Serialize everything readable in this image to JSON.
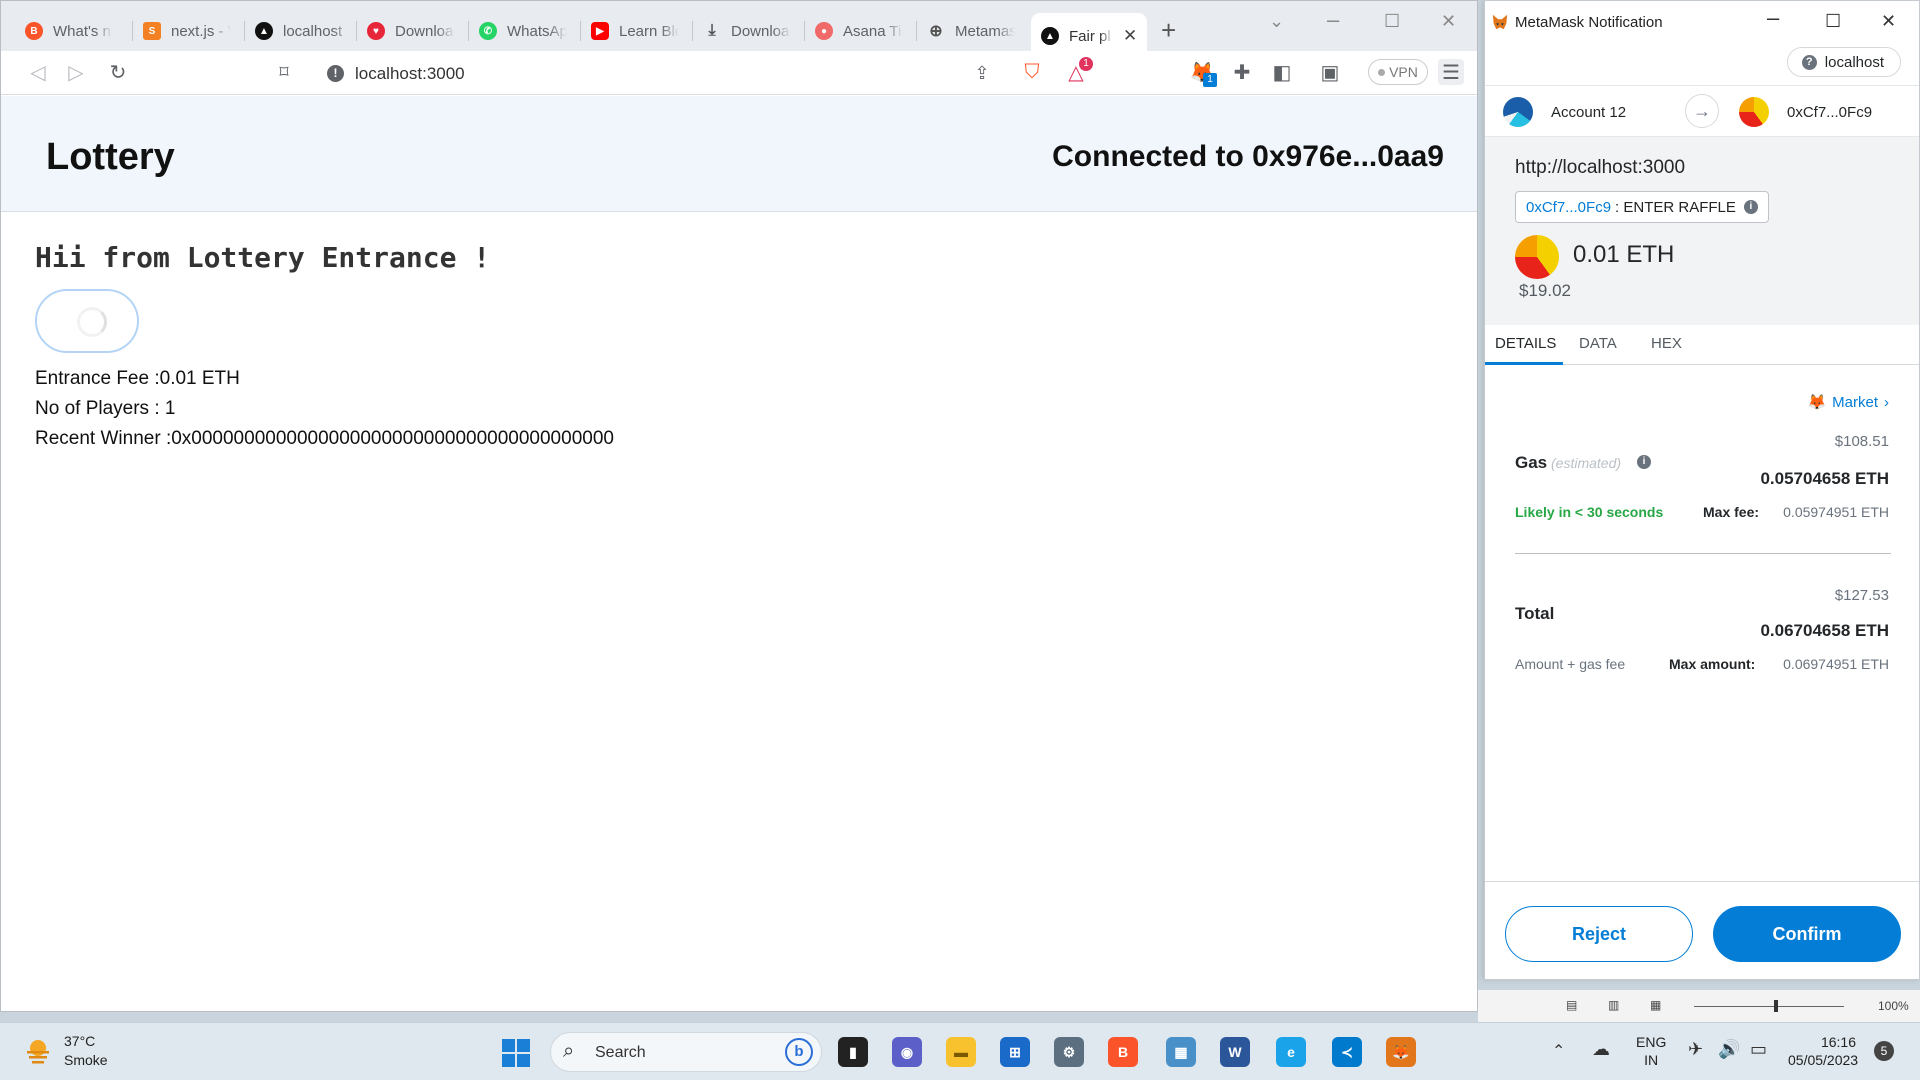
{
  "browser": {
    "tabs": [
      {
        "label": "What's ne",
        "icon": "brave-lion-icon"
      },
      {
        "label": "next.js - V",
        "icon": "stackoverflow-icon"
      },
      {
        "label": "localhost",
        "icon": "nextjs-icon"
      },
      {
        "label": "Download",
        "icon": "heart-icon"
      },
      {
        "label": "WhatsApp",
        "icon": "whatsapp-icon"
      },
      {
        "label": "Learn Bloc",
        "icon": "youtube-icon"
      },
      {
        "label": "Download",
        "icon": "download-icon"
      },
      {
        "label": "Asana Tim",
        "icon": "asana-icon"
      },
      {
        "label": "Metamask",
        "icon": "globe-icon"
      },
      {
        "label": "Fair pl",
        "icon": "nextjs-icon",
        "active": true
      }
    ],
    "url": "localhost:3000",
    "vpn_label": "VPN",
    "extension_badge": "1",
    "brave_rewards_badge": "1"
  },
  "page": {
    "title": "Lottery",
    "connected_text": "Connected to 0x976e...0aa9",
    "greeting": "Hii from Lottery Entrance !",
    "entrance_fee": "Entrance Fee :0.01 ETH",
    "players": "No of Players : 1",
    "recent_winner": "Recent Winner :0x0000000000000000000000000000000000000000"
  },
  "metamask": {
    "window_title": "MetaMask Notification",
    "network": "localhost",
    "from_account": "Account 12",
    "to_address": "0xCf7...0Fc9",
    "origin": "http://localhost:3000",
    "method_address": "0xCf7...0Fc9",
    "method_name": ": ENTER RAFFLE",
    "value": "0.01 ETH",
    "value_fiat": "$19.02",
    "tabs": [
      "DETAILS",
      "DATA",
      "HEX"
    ],
    "market_label": "Market",
    "gas_label": "Gas",
    "gas_estimated": "(estimated)",
    "gas_fiat": "$108.51",
    "gas_eth": "0.05704658 ETH",
    "likely_text": "Likely in < 30 seconds",
    "max_fee_label": "Max fee:",
    "max_fee_value": "0.05974951 ETH",
    "total_label": "Total",
    "total_fiat": "$127.53",
    "total_eth": "0.06704658 ETH",
    "amount_gas_label": "Amount + gas fee",
    "max_amount_label": "Max amount:",
    "max_amount_value": "0.06974951 ETH",
    "reject_label": "Reject",
    "confirm_label": "Confirm",
    "colors": {
      "primary": "#037dd6",
      "success": "#28a745"
    }
  },
  "word_status": {
    "zoom": "100%"
  },
  "taskbar": {
    "weather_temp": "37°C",
    "weather_cond": "Smoke",
    "search_label": "Search",
    "lang_line1": "ENG",
    "lang_line2": "IN",
    "time": "16:16",
    "date": "05/05/2023",
    "notif_count": "5"
  }
}
